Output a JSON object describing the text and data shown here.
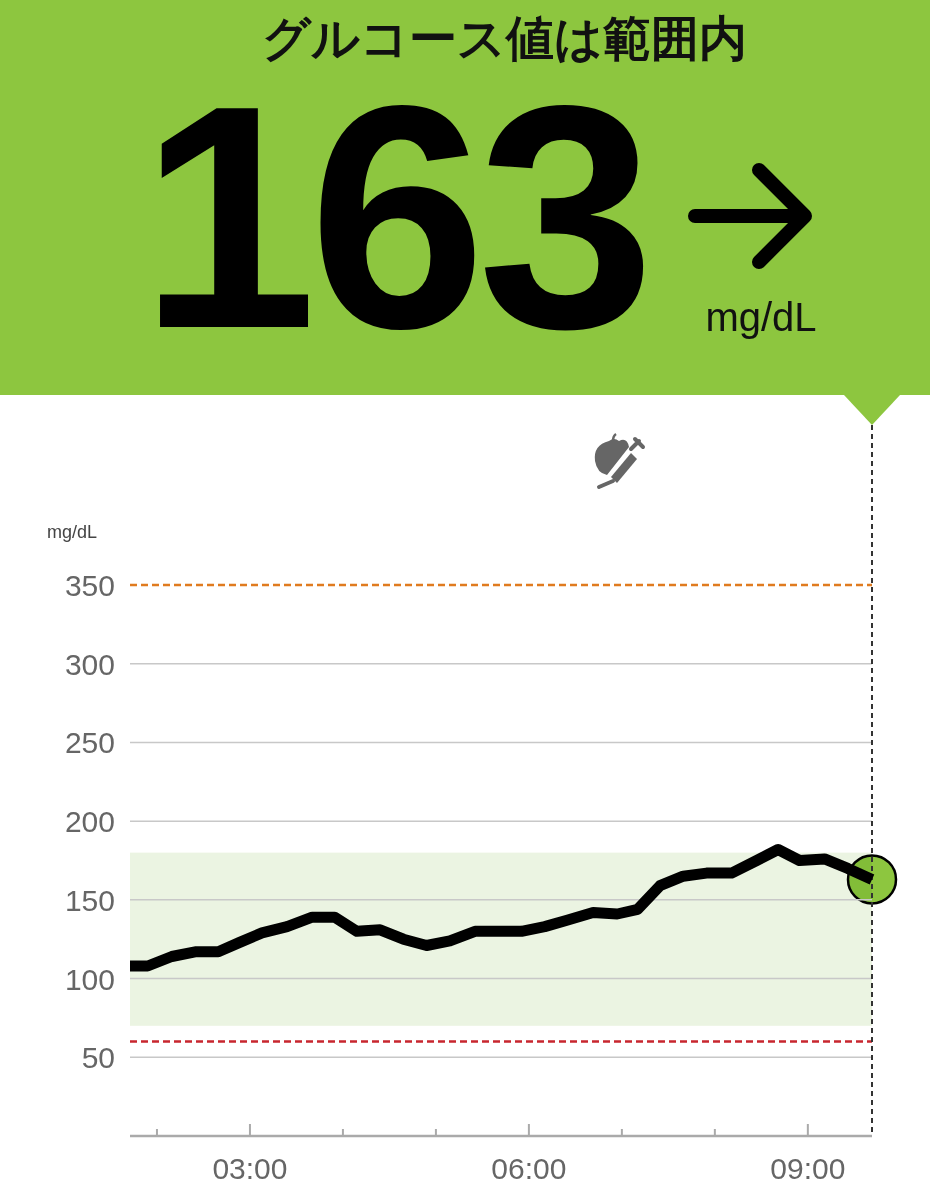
{
  "header": {
    "status": "グルコース値は範囲内",
    "value": "163",
    "unit": "mg/dL",
    "color": "#8dc63f"
  },
  "chart": {
    "unit_label": "mg/dL",
    "current_marker": {
      "color": "#8dc63f"
    },
    "chart_data": {
      "type": "line",
      "x": [
        1.71,
        1.9,
        2.16,
        2.41,
        2.66,
        2.89,
        3.13,
        3.4,
        3.67,
        3.91,
        4.15,
        4.4,
        4.65,
        4.9,
        5.15,
        5.42,
        5.69,
        5.92,
        6.17,
        6.41,
        6.69,
        6.95,
        7.17,
        7.41,
        7.66,
        7.91,
        8.18,
        8.45,
        8.68,
        8.91,
        9.18,
        9.43,
        9.69
      ],
      "values": [
        108,
        108,
        114,
        117,
        117,
        123,
        129,
        133,
        139,
        139,
        130,
        131,
        125,
        121,
        124,
        130,
        130,
        130,
        133,
        137,
        142,
        141,
        144,
        159,
        165,
        167,
        167,
        175,
        182,
        175,
        176,
        170,
        163
      ],
      "xlim": [
        1.71,
        9.69
      ],
      "ylim": [
        0,
        350
      ],
      "xticks": [
        {
          "value": 3,
          "label": "03:00"
        },
        {
          "value": 6,
          "label": "06:00"
        },
        {
          "value": 9,
          "label": "09:00"
        }
      ],
      "yticks": [
        50,
        100,
        150,
        200,
        250,
        300,
        350
      ],
      "grid": true,
      "bands": [
        {
          "axis": "y",
          "from": 70,
          "to": 180,
          "color": "#ebf4e2"
        }
      ],
      "ref_lines": [
        {
          "axis": "y",
          "value": 350,
          "color": "#e07b1f"
        },
        {
          "axis": "y",
          "value": 60,
          "color": "#c8262e"
        }
      ]
    }
  }
}
